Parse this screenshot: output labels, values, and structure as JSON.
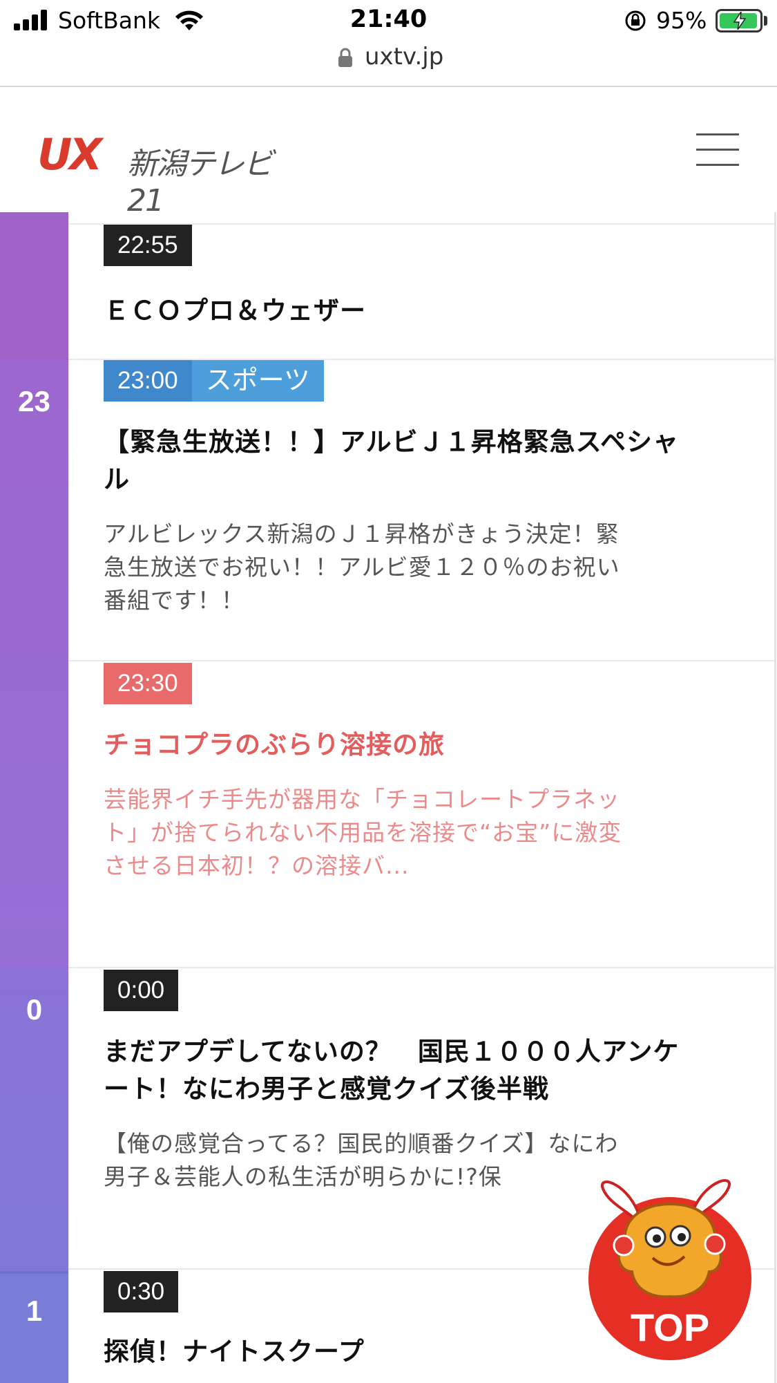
{
  "status_bar": {
    "carrier": "SoftBank",
    "time": "21:40",
    "battery_percent": "95%"
  },
  "url_bar": {
    "url": "uxtv.jp"
  },
  "header": {
    "logo_mark": "UX",
    "logo_name": "新潟テレビ21"
  },
  "schedule": {
    "hours": [
      "23",
      "0",
      "1"
    ],
    "programs": [
      {
        "time": "22:55",
        "genre": "",
        "title": "ＥＣＯプロ＆ウェザー",
        "description": ""
      },
      {
        "time": "23:00",
        "genre": "スポーツ",
        "title": "【緊急生放送！！】アルビＪ１昇格緊急スペシャル",
        "description": "アルビレックス新潟のＪ１昇格がきょう決定！緊急生放送でお祝い！！アルビ愛１２０％のお祝い番組です！！"
      },
      {
        "time": "23:30",
        "genre": "",
        "title": "チョコプラのぶらり溶接の旅",
        "description": "芸能界イチ手先が器用な「チョコレートプラネット」が捨てられない不用品を溶接で“お宝”に激変させる日本初！？の溶接バ..."
      },
      {
        "time": "0:00",
        "genre": "",
        "title": "まだアプデしてないの？　国民１０００人アンケート！なにわ男子と感覚クイズ後半戦",
        "description": "【俺の感覚合ってる？国民的順番クイズ】なにわ男子＆芸能人の私生活が明らかに!?保"
      },
      {
        "time": "0:30",
        "genre": "",
        "title": "探偵！ナイトスクープ",
        "description": ""
      }
    ]
  },
  "top_button": {
    "label": "TOP"
  },
  "colors": {
    "hour_col_23": "#9c6bd0",
    "hour_col_0": "#8a70d4",
    "accent_red": "#d93a2b",
    "genre_sports": "#4d9fdc",
    "onair": "#e96a6a"
  }
}
